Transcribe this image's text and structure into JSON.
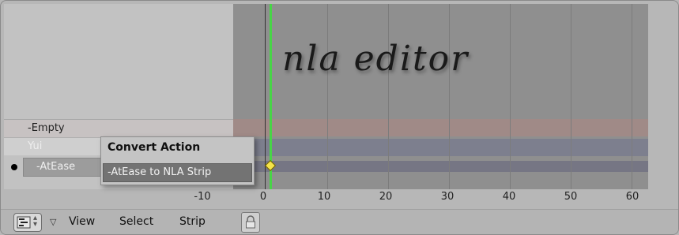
{
  "channels": {
    "empty_label": "-Empty",
    "yui_label": "Yui",
    "atease_label": "-AtEase"
  },
  "annotation": {
    "handwritten_text": "nla editor"
  },
  "ruler": {
    "ticks": [
      "-10",
      "0",
      "10",
      "20",
      "30",
      "40",
      "50",
      "60"
    ]
  },
  "popup": {
    "title": "Convert Action",
    "item": "-AtEase to NLA Strip"
  },
  "header": {
    "editor_type_icon": "nla-editor-icon",
    "menus": [
      "View",
      "Select",
      "Strip"
    ],
    "lock_icon": "lock-icon"
  },
  "colors": {
    "frame_cursor": "#48d447",
    "keyframe": "#f5e34a"
  }
}
